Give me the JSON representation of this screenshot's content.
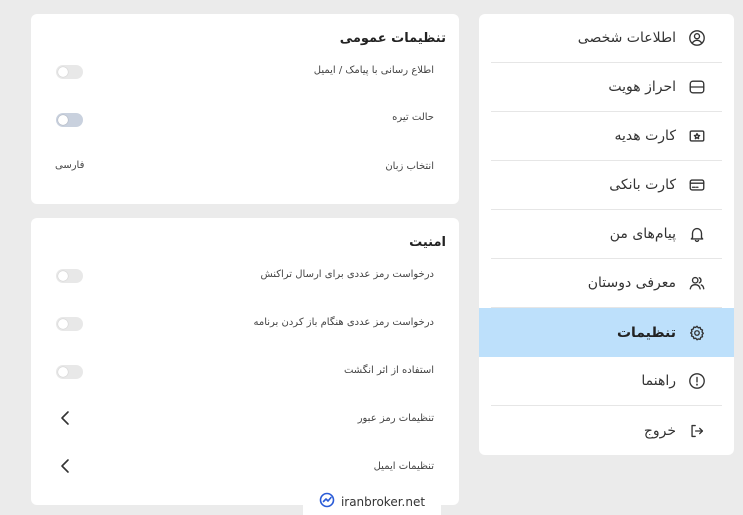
{
  "sidebar": {
    "items": [
      {
        "label": "اطلاعات شخصی",
        "icon": "user-circle-icon",
        "active": false
      },
      {
        "label": "احراز هویت",
        "icon": "id-card-icon",
        "active": false
      },
      {
        "label": "کارت هدیه",
        "icon": "gift-card-icon",
        "active": false
      },
      {
        "label": "کارت بانکی",
        "icon": "bank-card-icon",
        "active": false
      },
      {
        "label": "پیام‌های من",
        "icon": "bell-icon",
        "active": false
      },
      {
        "label": "معرفی دوستان",
        "icon": "users-icon",
        "active": false
      },
      {
        "label": "تنظیمات",
        "icon": "gear-icon",
        "active": true
      },
      {
        "label": "راهنما",
        "icon": "info-icon",
        "active": false
      },
      {
        "label": "خروج",
        "icon": "logout-icon",
        "active": false
      }
    ],
    "active_color": "#bde0fb"
  },
  "general": {
    "title": "تنظیمات عمومی",
    "sms_email_label": "اطلاع رسانی با پیامک / ایمیل",
    "dark_mode_label": "حالت تیره",
    "language_label": "انتخاب زبان",
    "language_value": "فارسی"
  },
  "security": {
    "title": "امنیت",
    "pin_transaction_label": "درخواست رمز عددی برای ارسال تراکنش",
    "pin_open_app_label": "درخواست رمز عددی هنگام باز کردن برنامه",
    "fingerprint_label": "استفاده از اثر انگشت",
    "password_settings_label": "تنظیمات رمز عبور",
    "email_settings_label": "تنظیمات ایمیل"
  },
  "watermark": {
    "text": "iranbroker.net"
  }
}
